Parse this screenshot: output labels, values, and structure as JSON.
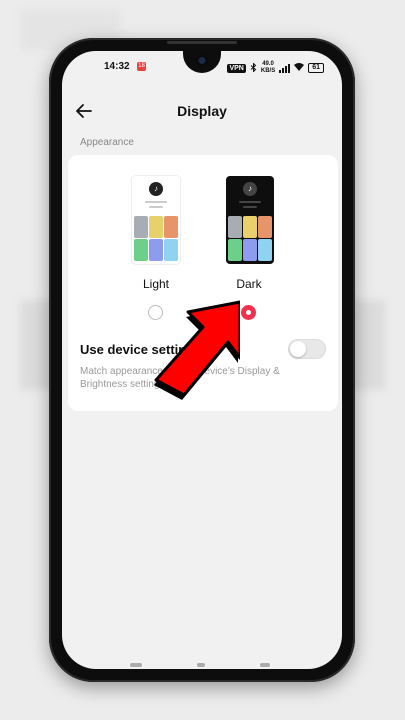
{
  "statusbar": {
    "time": "14:32",
    "notif_badge": "18",
    "vpn": "VPN",
    "speed_value": "49.0",
    "speed_unit": "KB/S",
    "battery": "61"
  },
  "header": {
    "title": "Display",
    "back_icon": "arrow-left-icon"
  },
  "appearance": {
    "section_label": "Appearance",
    "options": [
      {
        "label": "Light",
        "selected": false
      },
      {
        "label": "Dark",
        "selected": true
      }
    ],
    "preview_tile_colors": [
      "#a7adb3",
      "#e8d06a",
      "#e8946a",
      "#6ccf8a",
      "#8e9cf0",
      "#8fd3f0"
    ],
    "accent": "#f0324f"
  },
  "device_settings": {
    "label": "Use device settings",
    "description": "Match appearance to your device's Display & Brightness settings",
    "enabled": false
  },
  "annotation": {
    "icon": "red-arrow-pointer-icon",
    "color": "#ff0000"
  }
}
